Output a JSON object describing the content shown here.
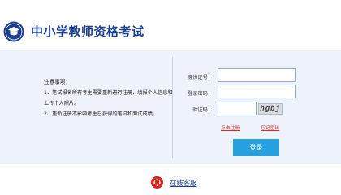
{
  "header": {
    "site_title": "中小学教师资格考试"
  },
  "notice": {
    "title": "注意事项：",
    "items": [
      "1、笔试报名所有考生需要重新进行注册、填报个人信息和上传个人照片。",
      "2、重新注册不影响考生已获得的笔试和面试成绩。"
    ]
  },
  "login_form": {
    "id_label": "身份证号：",
    "id_value": "",
    "password_label": "登录密码：",
    "password_value": "",
    "captcha_label": "验证码：",
    "captcha_value": "",
    "captcha_image_text": "hgbj",
    "register_link": "点击注册",
    "forgot_link": "忘记密码",
    "login_button": "登录"
  },
  "footer": {
    "online_service": "在线客服"
  },
  "colors": {
    "brand_blue": "#1b3f8f",
    "button_blue": "#26a0df",
    "link_red": "#e02a1b",
    "band_bg": "#eef3fb"
  }
}
